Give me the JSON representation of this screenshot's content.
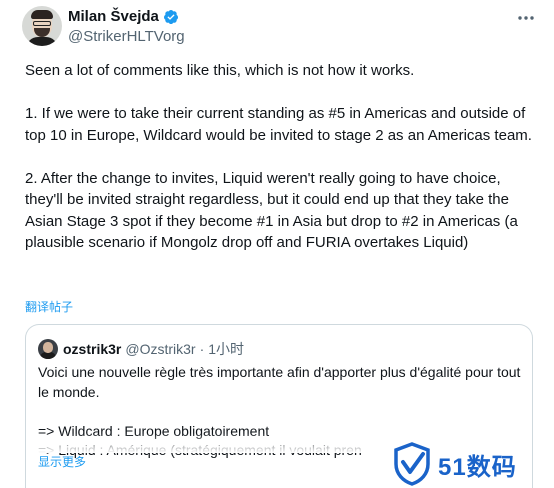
{
  "author": {
    "name": "Milan Švejda",
    "handle": "@StrikerHLTVorg"
  },
  "icons": {
    "verified": "verified-badge-icon",
    "more": "more-options-icon",
    "watermark": "shield-logo-icon"
  },
  "colors": {
    "verified": "#1d9bf0",
    "link": "#1d9bf0",
    "muted": "#536471",
    "watermark": "#1a63c9"
  },
  "tweet": {
    "paragraph1": "Seen a lot of comments like this, which is not how it works.",
    "paragraph2": "1. If we were to take their current standing as #5 in Americas and outside of top 10 in Europe, Wildcard would be invited to stage 2 as an Americas team.",
    "paragraph3": "2. After the change to invites, Liquid weren't really going to have choice, they'll be invited straight regardless, but it could end up that they take the Asian Stage 3 spot if they become #1 in Asia but drop to #2 in Americas (a plausible scenario if Mongolz drop off and FURIA overtakes Liquid)",
    "translate_label": "翻译帖子"
  },
  "quote": {
    "name": "ozstrik3r",
    "handle": "@Ozstrik3r",
    "separator": "·",
    "time": "1小时",
    "line1": "Voici une nouvelle règle très importante afin d'apporter plus d'égalité pour tout le monde.",
    "line2": "=> Wildcard : Europe obligatoirement",
    "line3": "=> Liquid : Amérique (stratégiquement il voulait pren",
    "show_more": "显示更多"
  },
  "watermark": {
    "text": "51数码"
  }
}
